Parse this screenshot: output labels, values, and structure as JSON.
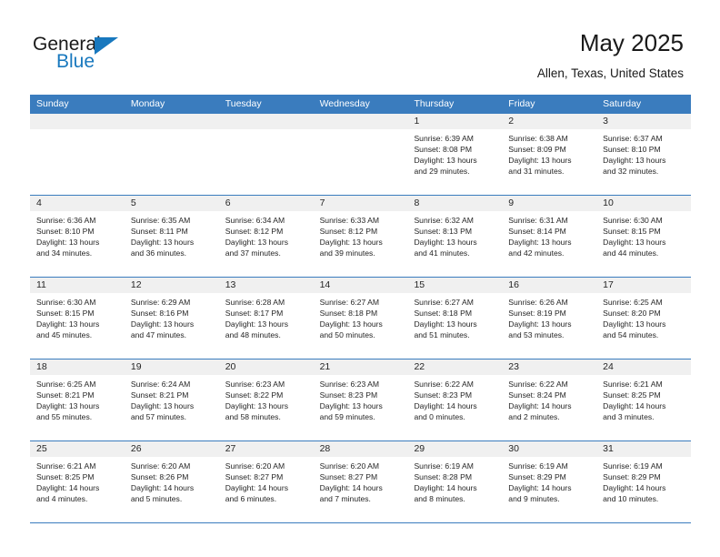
{
  "logo": {
    "word_general": "General",
    "word_blue": "Blue",
    "triangle_color": "#1878be"
  },
  "header": {
    "title": "May 2025",
    "location": "Allen, Texas, United States"
  },
  "theme": {
    "header_blue": "#3a7cbe",
    "day_band_gray": "#f0f0f0",
    "text_color": "#252525"
  },
  "weekdays": [
    "Sunday",
    "Monday",
    "Tuesday",
    "Wednesday",
    "Thursday",
    "Friday",
    "Saturday"
  ],
  "weeks": [
    [
      {
        "day": "",
        "sunrise": "",
        "sunset": "",
        "daylight_line1": "",
        "daylight_line2": ""
      },
      {
        "day": "",
        "sunrise": "",
        "sunset": "",
        "daylight_line1": "",
        "daylight_line2": ""
      },
      {
        "day": "",
        "sunrise": "",
        "sunset": "",
        "daylight_line1": "",
        "daylight_line2": ""
      },
      {
        "day": "",
        "sunrise": "",
        "sunset": "",
        "daylight_line1": "",
        "daylight_line2": ""
      },
      {
        "day": "1",
        "sunrise": "Sunrise: 6:39 AM",
        "sunset": "Sunset: 8:08 PM",
        "daylight_line1": "Daylight: 13 hours",
        "daylight_line2": "and 29 minutes."
      },
      {
        "day": "2",
        "sunrise": "Sunrise: 6:38 AM",
        "sunset": "Sunset: 8:09 PM",
        "daylight_line1": "Daylight: 13 hours",
        "daylight_line2": "and 31 minutes."
      },
      {
        "day": "3",
        "sunrise": "Sunrise: 6:37 AM",
        "sunset": "Sunset: 8:10 PM",
        "daylight_line1": "Daylight: 13 hours",
        "daylight_line2": "and 32 minutes."
      }
    ],
    [
      {
        "day": "4",
        "sunrise": "Sunrise: 6:36 AM",
        "sunset": "Sunset: 8:10 PM",
        "daylight_line1": "Daylight: 13 hours",
        "daylight_line2": "and 34 minutes."
      },
      {
        "day": "5",
        "sunrise": "Sunrise: 6:35 AM",
        "sunset": "Sunset: 8:11 PM",
        "daylight_line1": "Daylight: 13 hours",
        "daylight_line2": "and 36 minutes."
      },
      {
        "day": "6",
        "sunrise": "Sunrise: 6:34 AM",
        "sunset": "Sunset: 8:12 PM",
        "daylight_line1": "Daylight: 13 hours",
        "daylight_line2": "and 37 minutes."
      },
      {
        "day": "7",
        "sunrise": "Sunrise: 6:33 AM",
        "sunset": "Sunset: 8:12 PM",
        "daylight_line1": "Daylight: 13 hours",
        "daylight_line2": "and 39 minutes."
      },
      {
        "day": "8",
        "sunrise": "Sunrise: 6:32 AM",
        "sunset": "Sunset: 8:13 PM",
        "daylight_line1": "Daylight: 13 hours",
        "daylight_line2": "and 41 minutes."
      },
      {
        "day": "9",
        "sunrise": "Sunrise: 6:31 AM",
        "sunset": "Sunset: 8:14 PM",
        "daylight_line1": "Daylight: 13 hours",
        "daylight_line2": "and 42 minutes."
      },
      {
        "day": "10",
        "sunrise": "Sunrise: 6:30 AM",
        "sunset": "Sunset: 8:15 PM",
        "daylight_line1": "Daylight: 13 hours",
        "daylight_line2": "and 44 minutes."
      }
    ],
    [
      {
        "day": "11",
        "sunrise": "Sunrise: 6:30 AM",
        "sunset": "Sunset: 8:15 PM",
        "daylight_line1": "Daylight: 13 hours",
        "daylight_line2": "and 45 minutes."
      },
      {
        "day": "12",
        "sunrise": "Sunrise: 6:29 AM",
        "sunset": "Sunset: 8:16 PM",
        "daylight_line1": "Daylight: 13 hours",
        "daylight_line2": "and 47 minutes."
      },
      {
        "day": "13",
        "sunrise": "Sunrise: 6:28 AM",
        "sunset": "Sunset: 8:17 PM",
        "daylight_line1": "Daylight: 13 hours",
        "daylight_line2": "and 48 minutes."
      },
      {
        "day": "14",
        "sunrise": "Sunrise: 6:27 AM",
        "sunset": "Sunset: 8:18 PM",
        "daylight_line1": "Daylight: 13 hours",
        "daylight_line2": "and 50 minutes."
      },
      {
        "day": "15",
        "sunrise": "Sunrise: 6:27 AM",
        "sunset": "Sunset: 8:18 PM",
        "daylight_line1": "Daylight: 13 hours",
        "daylight_line2": "and 51 minutes."
      },
      {
        "day": "16",
        "sunrise": "Sunrise: 6:26 AM",
        "sunset": "Sunset: 8:19 PM",
        "daylight_line1": "Daylight: 13 hours",
        "daylight_line2": "and 53 minutes."
      },
      {
        "day": "17",
        "sunrise": "Sunrise: 6:25 AM",
        "sunset": "Sunset: 8:20 PM",
        "daylight_line1": "Daylight: 13 hours",
        "daylight_line2": "and 54 minutes."
      }
    ],
    [
      {
        "day": "18",
        "sunrise": "Sunrise: 6:25 AM",
        "sunset": "Sunset: 8:21 PM",
        "daylight_line1": "Daylight: 13 hours",
        "daylight_line2": "and 55 minutes."
      },
      {
        "day": "19",
        "sunrise": "Sunrise: 6:24 AM",
        "sunset": "Sunset: 8:21 PM",
        "daylight_line1": "Daylight: 13 hours",
        "daylight_line2": "and 57 minutes."
      },
      {
        "day": "20",
        "sunrise": "Sunrise: 6:23 AM",
        "sunset": "Sunset: 8:22 PM",
        "daylight_line1": "Daylight: 13 hours",
        "daylight_line2": "and 58 minutes."
      },
      {
        "day": "21",
        "sunrise": "Sunrise: 6:23 AM",
        "sunset": "Sunset: 8:23 PM",
        "daylight_line1": "Daylight: 13 hours",
        "daylight_line2": "and 59 minutes."
      },
      {
        "day": "22",
        "sunrise": "Sunrise: 6:22 AM",
        "sunset": "Sunset: 8:23 PM",
        "daylight_line1": "Daylight: 14 hours",
        "daylight_line2": "and 0 minutes."
      },
      {
        "day": "23",
        "sunrise": "Sunrise: 6:22 AM",
        "sunset": "Sunset: 8:24 PM",
        "daylight_line1": "Daylight: 14 hours",
        "daylight_line2": "and 2 minutes."
      },
      {
        "day": "24",
        "sunrise": "Sunrise: 6:21 AM",
        "sunset": "Sunset: 8:25 PM",
        "daylight_line1": "Daylight: 14 hours",
        "daylight_line2": "and 3 minutes."
      }
    ],
    [
      {
        "day": "25",
        "sunrise": "Sunrise: 6:21 AM",
        "sunset": "Sunset: 8:25 PM",
        "daylight_line1": "Daylight: 14 hours",
        "daylight_line2": "and 4 minutes."
      },
      {
        "day": "26",
        "sunrise": "Sunrise: 6:20 AM",
        "sunset": "Sunset: 8:26 PM",
        "daylight_line1": "Daylight: 14 hours",
        "daylight_line2": "and 5 minutes."
      },
      {
        "day": "27",
        "sunrise": "Sunrise: 6:20 AM",
        "sunset": "Sunset: 8:27 PM",
        "daylight_line1": "Daylight: 14 hours",
        "daylight_line2": "and 6 minutes."
      },
      {
        "day": "28",
        "sunrise": "Sunrise: 6:20 AM",
        "sunset": "Sunset: 8:27 PM",
        "daylight_line1": "Daylight: 14 hours",
        "daylight_line2": "and 7 minutes."
      },
      {
        "day": "29",
        "sunrise": "Sunrise: 6:19 AM",
        "sunset": "Sunset: 8:28 PM",
        "daylight_line1": "Daylight: 14 hours",
        "daylight_line2": "and 8 minutes."
      },
      {
        "day": "30",
        "sunrise": "Sunrise: 6:19 AM",
        "sunset": "Sunset: 8:29 PM",
        "daylight_line1": "Daylight: 14 hours",
        "daylight_line2": "and 9 minutes."
      },
      {
        "day": "31",
        "sunrise": "Sunrise: 6:19 AM",
        "sunset": "Sunset: 8:29 PM",
        "daylight_line1": "Daylight: 14 hours",
        "daylight_line2": "and 10 minutes."
      }
    ]
  ]
}
